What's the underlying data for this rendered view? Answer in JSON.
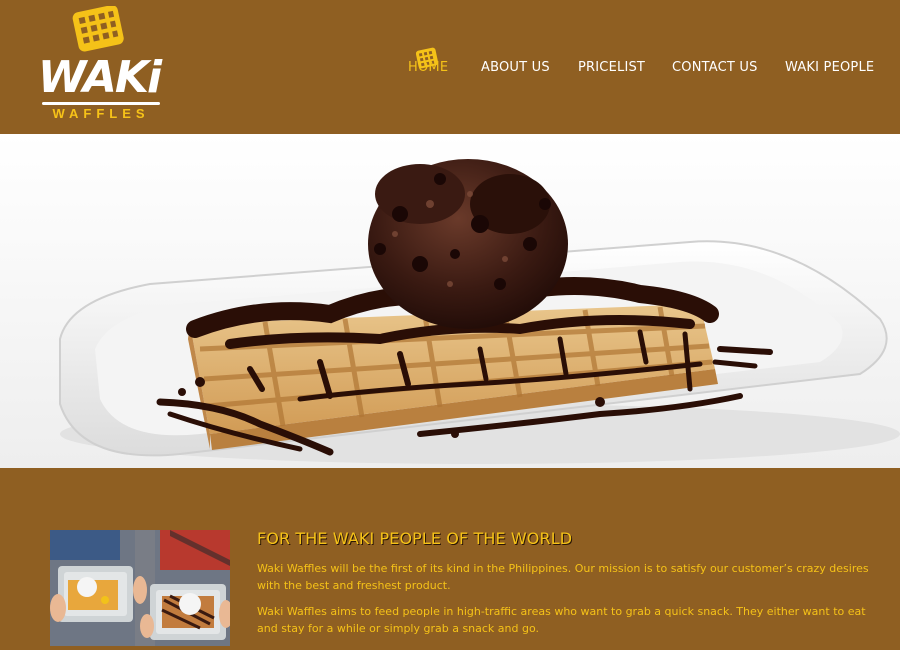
{
  "brand": {
    "logo_word": "WAKi",
    "logo_sub": "WAFFLES",
    "colors": {
      "background": "#8f5f22",
      "accent": "#f5c218",
      "white": "#ffffff"
    }
  },
  "nav": {
    "items": [
      {
        "label": "HOME",
        "active": true,
        "icon": "waffle-icon"
      },
      {
        "label": "ABOUT US",
        "active": false
      },
      {
        "label": "PRICELIST",
        "active": false
      },
      {
        "label": "CONTACT US",
        "active": false
      },
      {
        "label": "WAKI PEOPLE",
        "active": false
      }
    ]
  },
  "hero": {
    "image": "chocolate waffle with ice cream on a white plate"
  },
  "about": {
    "heading": "FOR THE WAKI PEOPLE OF THE WORLD",
    "paragraphs": [
      "Waki Waffles will be the first of its kind in the Philippines. Our mission is to satisfy our customer’s crazy desires with the best and freshest product.",
      "Waki Waffles aims to feed people in high-traffic areas who want to grab a quick snack. They either want to eat and stay for a while or simply grab a snack and go."
    ]
  }
}
